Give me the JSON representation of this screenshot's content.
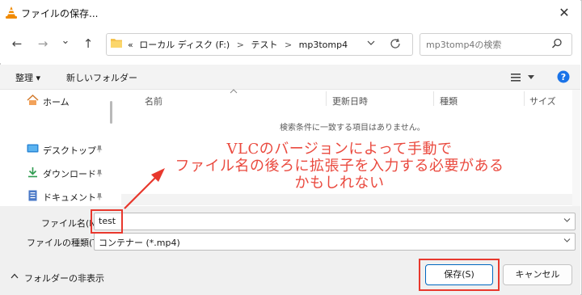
{
  "window": {
    "title": "ファイルの保存...",
    "close_symbol": "✕"
  },
  "nav": {
    "back_symbol": "←",
    "forward_symbol": "→",
    "dropdown_symbol": "⌄",
    "up_symbol": "↑",
    "breadcrumb_prefix": "«",
    "breadcrumb": [
      "ローカル ディスク (F:)",
      "テスト",
      "mp3tomp4"
    ],
    "breadcrumb_sep": ">",
    "search_placeholder": "mp3tomp4の検索"
  },
  "toolbar": {
    "organize": "整理 ▾",
    "new_folder": "新しいフォルダー"
  },
  "sidebar": {
    "items": [
      {
        "label": "ホーム",
        "icon": "home-icon"
      },
      {
        "label": "デスクトップ",
        "icon": "desktop-icon"
      },
      {
        "label": "ダウンロード",
        "icon": "download-icon"
      },
      {
        "label": "ドキュメント",
        "icon": "document-icon"
      }
    ]
  },
  "filelist": {
    "columns": [
      "名前",
      "更新日時",
      "種類",
      "サイズ"
    ],
    "empty_message": "検索条件に一致する項目はありません。"
  },
  "form": {
    "filename_label": "ファイル名(N):",
    "filename_value": "test",
    "filetype_label": "ファイルの種類(T):",
    "filetype_value": "コンテナー (*.mp4)"
  },
  "footer": {
    "hide_folders": "フォルダーの非表示",
    "save_button": "保存(S)",
    "cancel_button": "キャンセル"
  },
  "annotation": {
    "lines": [
      "VLCのバージョンによって手動で",
      "ファイル名の後ろに拡張子を入力する必要がある",
      "かもしれない"
    ],
    "color": "#ea4a3f"
  },
  "colors": {
    "accent": "#0067c0",
    "highlight": "#e8382d",
    "help_badge": "#1a73e8"
  }
}
